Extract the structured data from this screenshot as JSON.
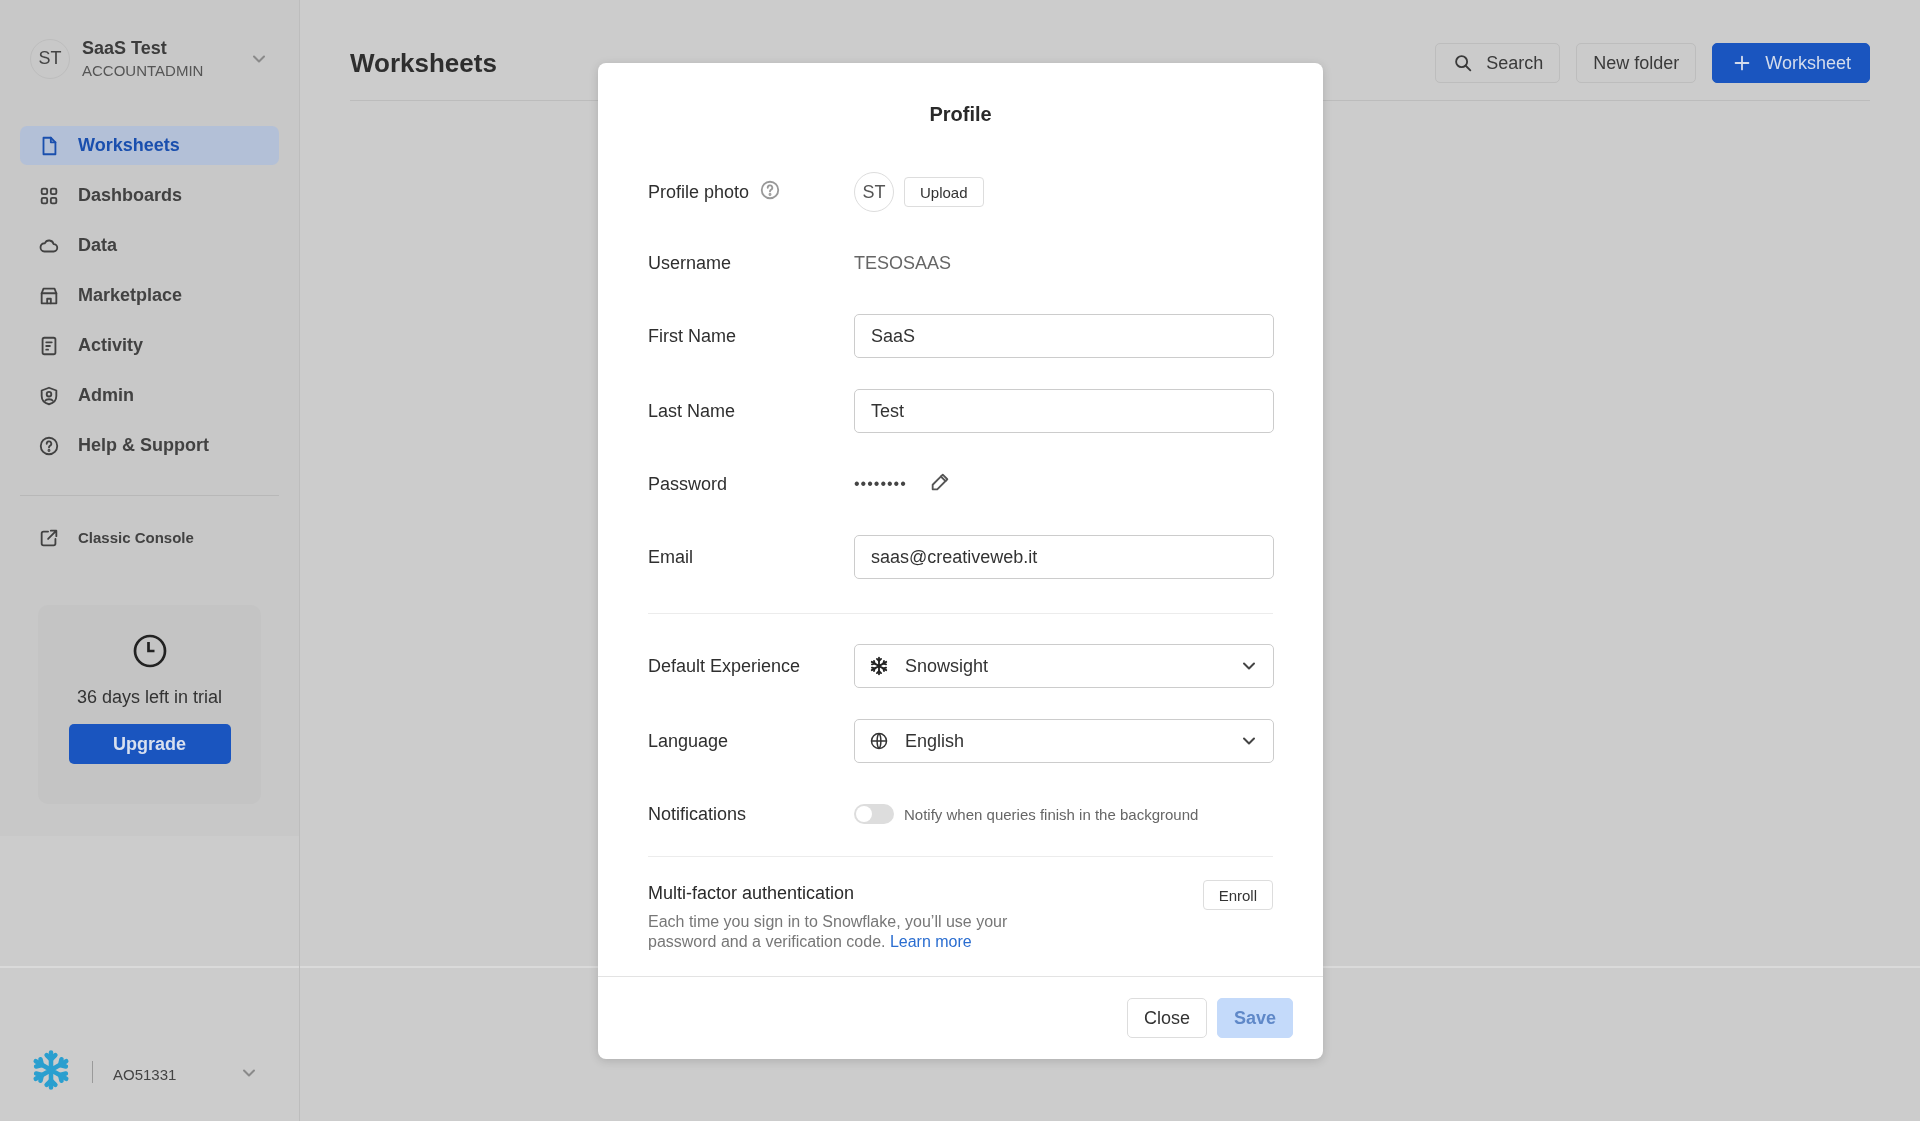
{
  "account": {
    "initials": "ST",
    "name": "SaaS Test",
    "role": "ACCOUNTADMIN"
  },
  "nav": [
    {
      "label": "Worksheets",
      "selected": true
    },
    {
      "label": "Dashboards",
      "selected": false
    },
    {
      "label": "Data",
      "selected": false
    },
    {
      "label": "Marketplace",
      "selected": false
    },
    {
      "label": "Activity",
      "selected": false
    },
    {
      "label": "Admin",
      "selected": false
    },
    {
      "label": "Help & Support",
      "selected": false
    }
  ],
  "classic_console": {
    "label": "Classic Console"
  },
  "trial": {
    "text": "36 days left in trial",
    "button": "Upgrade"
  },
  "footer": {
    "account_id": "AO51331"
  },
  "header": {
    "title": "Worksheets",
    "buttons": [
      {
        "label": "Search",
        "kind": "search"
      },
      {
        "label": "New folder",
        "kind": "plain"
      },
      {
        "label": "Worksheet",
        "kind": "primary"
      }
    ]
  },
  "modal": {
    "title": "Profile",
    "sections": [
      [
        {
          "kind": "photo",
          "label": "Profile photo",
          "initials": "ST",
          "button": "Upload"
        },
        {
          "kind": "text",
          "label": "Username",
          "value": "TESOSAAS"
        },
        {
          "kind": "input",
          "label": "First Name",
          "value": "SaaS"
        },
        {
          "kind": "input",
          "label": "Last Name",
          "value": "Test"
        },
        {
          "kind": "password",
          "label": "Password",
          "value": "••••••••"
        },
        {
          "kind": "input",
          "label": "Email",
          "value": "saas@creativeweb.it"
        }
      ],
      [
        {
          "kind": "select",
          "label": "Default Experience",
          "value": "Snowsight"
        },
        {
          "kind": "select",
          "label": "Language",
          "value": "English"
        },
        {
          "kind": "toggle",
          "label": "Notifications",
          "text": "Notify when queries finish in the background",
          "on": false
        }
      ]
    ],
    "mfa": {
      "title": "Multi-factor authentication",
      "description": "Each time you sign in to Snowflake, you’ll use your password and a verification code.",
      "link": "Learn more",
      "button": "Enroll"
    },
    "buttons": [
      {
        "label": "Close",
        "kind": "secondary",
        "disabled": false
      },
      {
        "label": "Save",
        "kind": "primary",
        "disabled": true
      }
    ]
  }
}
